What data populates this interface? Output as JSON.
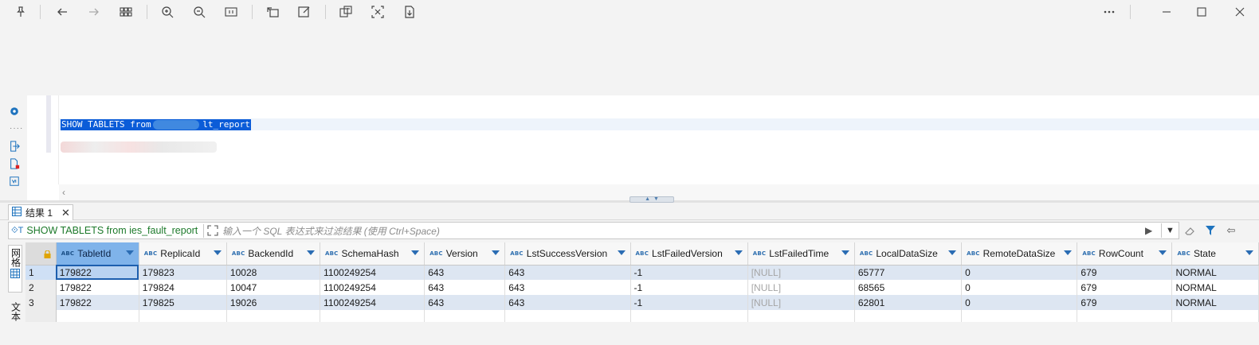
{
  "toolbar": {
    "buttons": [
      "pin-icon",
      "back-icon",
      "forward-icon",
      "apps-icon",
      "zoom-in-icon",
      "zoom-out-icon",
      "fit-icon",
      "rotate-icon",
      "edit-icon",
      "translate-icon",
      "crop-icon",
      "download-icon"
    ],
    "window": [
      "more-icon",
      "minimize-icon",
      "maximize-icon",
      "close-icon"
    ]
  },
  "editor": {
    "query": "SHOW TABLETS from ",
    "query_tail": "lt_report"
  },
  "results": {
    "tab_label": "结果 1",
    "tab_close": "✕",
    "filter_query": "SHOW TABLETS from ies_fault_report",
    "filter_placeholder": "输入一个 SQL 表达式来过滤结果 (使用 Ctrl+Space)",
    "side_tab_grid": "网格",
    "side_tab_text": "文本"
  },
  "grid": {
    "columns": [
      "TabletId",
      "ReplicaId",
      "BackendId",
      "SchemaHash",
      "Version",
      "LstSuccessVersion",
      "LstFailedVersion",
      "LstFailedTime",
      "LocalDataSize",
      "RemoteDataSize",
      "RowCount",
      "State"
    ],
    "type_badge": "ABC",
    "rows": [
      [
        "1",
        "179822",
        "179823",
        "10028",
        "1100249254",
        "643",
        "643",
        "-1",
        "[NULL]",
        "65777",
        "0",
        "679",
        "NORMAL"
      ],
      [
        "2",
        "179822",
        "179824",
        "10047",
        "1100249254",
        "643",
        "643",
        "-1",
        "[NULL]",
        "68565",
        "0",
        "679",
        "NORMAL"
      ],
      [
        "3",
        "179822",
        "179825",
        "19026",
        "1100249254",
        "643",
        "643",
        "-1",
        "[NULL]",
        "62801",
        "0",
        "679",
        "NORMAL"
      ]
    ]
  },
  "colors": {
    "selection": "#0b5cd8",
    "sorted_header": "#7fb3ea",
    "row_stripe": "#dde6f2",
    "filter_text": "#1d7a2b"
  }
}
